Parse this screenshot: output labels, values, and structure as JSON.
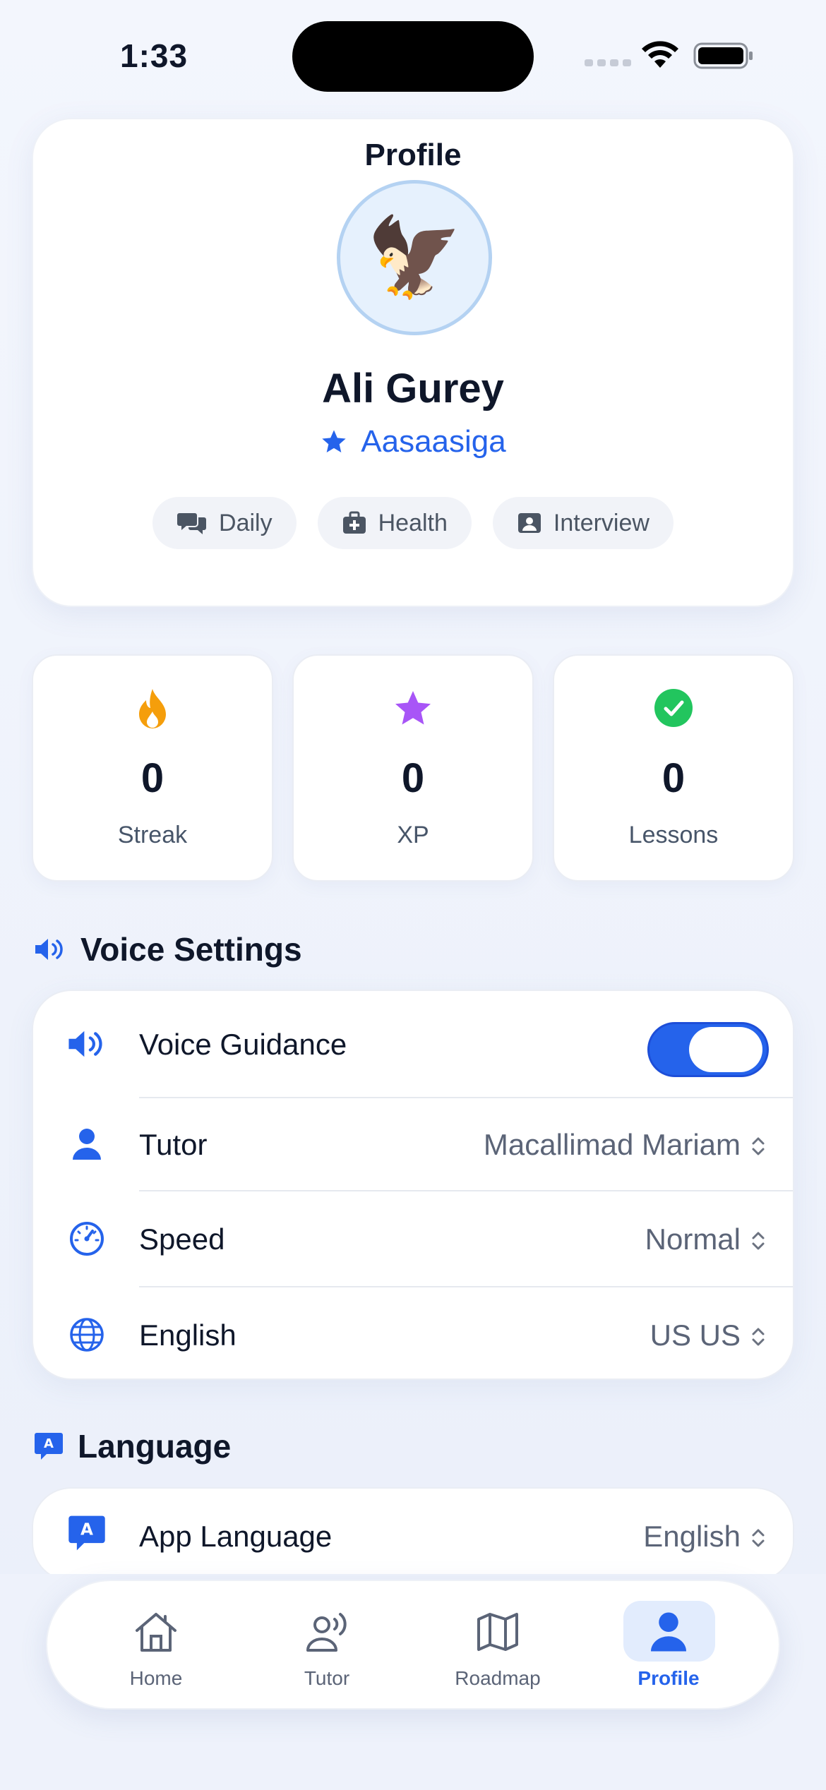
{
  "status_bar": {
    "time": "1:33"
  },
  "profile": {
    "title": "Profile",
    "avatar_emoji": "🦅",
    "name": "Ali Gurey",
    "level": "Aasaasiga",
    "chips": [
      {
        "label": "Daily",
        "icon": "chat-bubbles-icon"
      },
      {
        "label": "Health",
        "icon": "medical-kit-icon"
      },
      {
        "label": "Interview",
        "icon": "id-card-icon"
      }
    ]
  },
  "stats": [
    {
      "value": "0",
      "label": "Streak",
      "icon": "flame-icon",
      "color": "#f59e0b"
    },
    {
      "value": "0",
      "label": "XP",
      "icon": "star-icon",
      "color": "#a855f7"
    },
    {
      "value": "0",
      "label": "Lessons",
      "icon": "check-circle-icon",
      "color": "#22c55e"
    }
  ],
  "voice_settings": {
    "title": "Voice Settings",
    "rows": [
      {
        "label": "Voice Guidance",
        "toggle_on": true
      },
      {
        "label": "Tutor",
        "value": "Macallimad Mariam"
      },
      {
        "label": "Speed",
        "value": "Normal"
      },
      {
        "label": "English",
        "value": "US US"
      }
    ]
  },
  "language": {
    "title": "Language",
    "app_language_label": "App Language",
    "app_language_value": "English"
  },
  "nav": {
    "items": [
      {
        "label": "Home",
        "icon": "home-icon"
      },
      {
        "label": "Tutor",
        "icon": "tutor-voice-icon"
      },
      {
        "label": "Roadmap",
        "icon": "map-icon"
      },
      {
        "label": "Profile",
        "icon": "person-icon"
      }
    ],
    "active": "Profile"
  },
  "colors": {
    "accent": "#2563eb",
    "text": "#0f172a",
    "muted": "#5b6477"
  }
}
